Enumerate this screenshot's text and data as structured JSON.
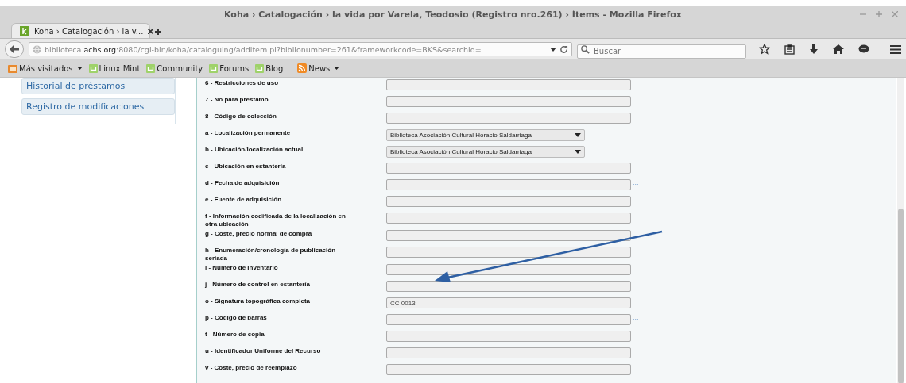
{
  "window": {
    "title": "Koha › Catalogación › la vida por Varela, Teodosio (Registro nro.261) › Ítems - Mozilla Firefox"
  },
  "tabs": [
    {
      "label": "Koha › Catalogación › la v...",
      "selected": true
    }
  ],
  "address_bar": {
    "url_host_pre": "biblioteca.",
    "url_host": "achs.org",
    "url_rest": ":8080/cgi-bin/koha/cataloguing/additem.pl?biblionumber=261&frameworkcode=BKS&searchid="
  },
  "search": {
    "placeholder": "Buscar"
  },
  "bookmarks": [
    {
      "kind": "folder",
      "label": "Más visitados"
    },
    {
      "kind": "mint",
      "label": "Linux Mint"
    },
    {
      "kind": "mint",
      "label": "Community"
    },
    {
      "kind": "mint",
      "label": "Forums"
    },
    {
      "kind": "mint",
      "label": "Blog"
    },
    {
      "kind": "feed",
      "label": "News"
    }
  ],
  "sidebar": {
    "items": [
      {
        "label": "Historial de préstamos"
      },
      {
        "label": "Registro de modificaciones"
      }
    ]
  },
  "form": {
    "rows": [
      {
        "label": "6 - Restricciones de uso",
        "kind": "text"
      },
      {
        "label": "7 - No para préstamo",
        "kind": "text"
      },
      {
        "label": "8 - Código de colección",
        "kind": "text"
      },
      {
        "label": "a - Localización permanente",
        "kind": "select",
        "value": "Biblioteca Asociación Cultural Horacio Saldarriaga"
      },
      {
        "label": "b - Ubicación/localización actual",
        "kind": "select",
        "value": "Biblioteca Asociación Cultural Horacio Saldarriaga"
      },
      {
        "label": "c - Ubicación en estantería",
        "kind": "text"
      },
      {
        "label": "d - Fecha de adquisición",
        "kind": "text",
        "link": "..."
      },
      {
        "label": "e - Fuente de adquisición",
        "kind": "text"
      },
      {
        "label": "f - Información codificada de la localización en otra ubicación",
        "kind": "text"
      },
      {
        "label": "g - Coste, precio normal de compra",
        "kind": "text"
      },
      {
        "label": "h - Enumeración/cronología de publicación seriada",
        "kind": "text"
      },
      {
        "label": "i - Número de inventario",
        "kind": "text"
      },
      {
        "label": "j - Número de control en estantería",
        "kind": "text"
      },
      {
        "label": "o - Signatura topográfica completa",
        "kind": "text",
        "value": "CC 0013"
      },
      {
        "label": "p - Código de barras",
        "kind": "text",
        "link": "..."
      },
      {
        "label": "t - Número de copia",
        "kind": "text"
      },
      {
        "label": "u - Identificador Uniforme del Recurso",
        "kind": "text"
      },
      {
        "label": "v - Coste, precio de reemplazo",
        "kind": "text"
      }
    ]
  }
}
